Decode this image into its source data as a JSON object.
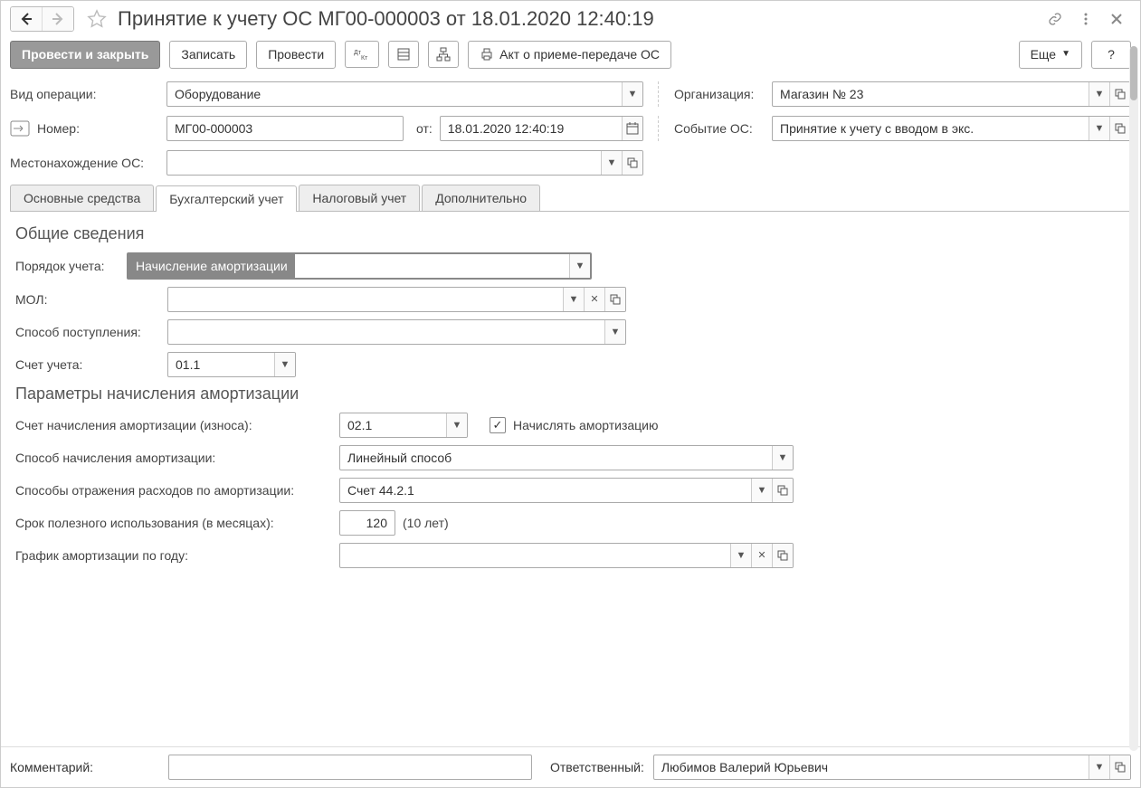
{
  "title": "Принятие к учету ОС МГ00-000003 от 18.01.2020 12:40:19",
  "toolbar": {
    "post_close": "Провести и закрыть",
    "write": "Записать",
    "post": "Провести",
    "act": "Акт о приеме-передаче ОС",
    "more": "Еще",
    "help": "?"
  },
  "header": {
    "op_type_label": "Вид операции:",
    "op_type_value": "Оборудование",
    "number_label": "Номер:",
    "number_value": "МГ00-000003",
    "from_label": "от:",
    "date_value": "18.01.2020 12:40:19",
    "location_label": "Местонахождение ОС:",
    "location_value": "",
    "org_label": "Организация:",
    "org_value": "Магазин № 23",
    "event_label": "Событие ОС:",
    "event_value": "Принятие к учету с вводом в экс."
  },
  "tabs": {
    "t1": "Основные средства",
    "t2": "Бухгалтерский учет",
    "t3": "Налоговый учет",
    "t4": "Дополнительно"
  },
  "general": {
    "title": "Общие сведения",
    "order_label": "Порядок учета:",
    "order_value": "Начисление амортизации",
    "mol_label": "МОЛ:",
    "mol_value": "",
    "receipt_label": "Способ поступления:",
    "receipt_value": "",
    "account_label": "Счет учета:",
    "account_value": "01.1"
  },
  "amort": {
    "title": "Параметры начисления амортизации",
    "acc_label": "Счет начисления амортизации (износа):",
    "acc_value": "02.1",
    "do_amort_label": "Начислять амортизацию",
    "method_label": "Способ начисления амортизации:",
    "method_value": "Линейный способ",
    "expense_label": "Способы отражения расходов по амортизации:",
    "expense_value": "Счет 44.2.1",
    "life_label": "Срок полезного использования (в месяцах):",
    "life_value": "120",
    "life_hint": "(10 лет)",
    "sched_label": "График амортизации по году:",
    "sched_value": ""
  },
  "footer": {
    "comment_label": "Комментарий:",
    "comment_value": "",
    "responsible_label": "Ответственный:",
    "responsible_value": "Любимов Валерий Юрьевич"
  }
}
